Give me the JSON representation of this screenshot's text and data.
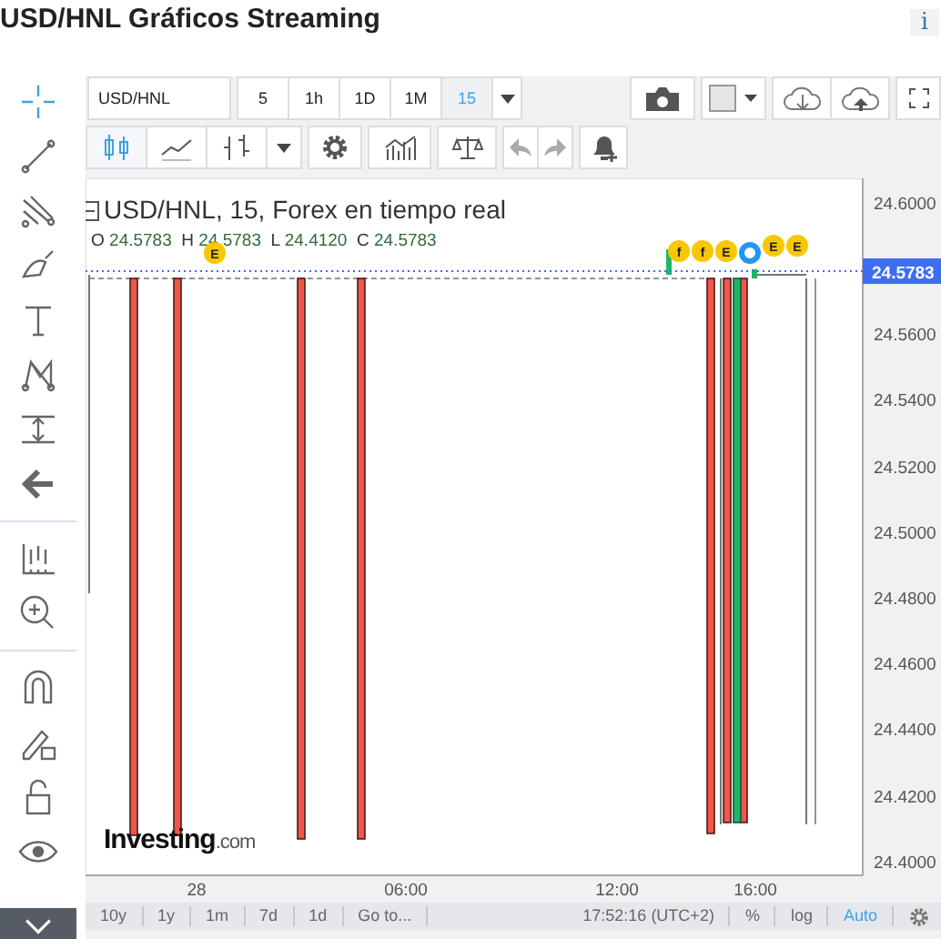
{
  "title": "USD/HNL Gráficos Streaming",
  "info": "i",
  "tools": [
    {
      "kind": "crosshair",
      "selected": true
    },
    {
      "kind": "trendline",
      "selected": false
    },
    {
      "kind": "pitchfork",
      "selected": false
    },
    {
      "kind": "brush",
      "selected": false
    },
    {
      "kind": "text",
      "selected": false
    },
    {
      "kind": "pattern",
      "selected": false
    },
    {
      "kind": "measure",
      "selected": false
    },
    {
      "kind": "arrow",
      "selected": false
    },
    {
      "kind": "ruler",
      "selected": false
    },
    {
      "kind": "zoom",
      "selected": false
    },
    {
      "kind": "magnet",
      "selected": false
    },
    {
      "kind": "pencil-lock",
      "selected": false
    },
    {
      "kind": "lock",
      "selected": false
    },
    {
      "kind": "eye",
      "selected": false
    }
  ],
  "symbol": "USD/HNL",
  "intervals": [
    {
      "label": "5",
      "selected": false
    },
    {
      "label": "1h",
      "selected": false
    },
    {
      "label": "1D",
      "selected": false
    },
    {
      "label": "1M",
      "selected": false
    },
    {
      "label": "15",
      "selected": true
    }
  ],
  "chart_types": [
    {
      "kind": "candles",
      "selected": true
    },
    {
      "kind": "line",
      "selected": false
    },
    {
      "kind": "bars",
      "selected": false
    }
  ],
  "legend": {
    "title": "USD/HNL, 15, Forex en tiempo real",
    "ohlc": [
      {
        "key": "O",
        "value": "24.5783"
      },
      {
        "key": "H",
        "value": "24.5783"
      },
      {
        "key": "L",
        "value": "24.4120"
      },
      {
        "key": "C",
        "value": "24.5783"
      }
    ]
  },
  "price_ticks": [
    "24.6000",
    "24.5600",
    "24.5400",
    "24.5200",
    "24.5000",
    "24.4800",
    "24.4600",
    "24.4400",
    "24.4200",
    "24.4000"
  ],
  "current_price": "24.5783",
  "time_ticks": [
    "28",
    "06:00",
    "12:00",
    "16:00"
  ],
  "markers": [
    "E",
    "f",
    "f",
    "E",
    "E",
    "E"
  ],
  "logo": {
    "name": "Investing",
    "suffix": ".com"
  },
  "ranges": [
    "10y",
    "1y",
    "1m",
    "7d",
    "1d"
  ],
  "goto": "Go to...",
  "clock": "17:52:16 (UTC+2)",
  "scale_options": [
    {
      "label": "%",
      "selected": false
    },
    {
      "label": "log",
      "selected": false
    },
    {
      "label": "Auto",
      "selected": true
    }
  ]
}
